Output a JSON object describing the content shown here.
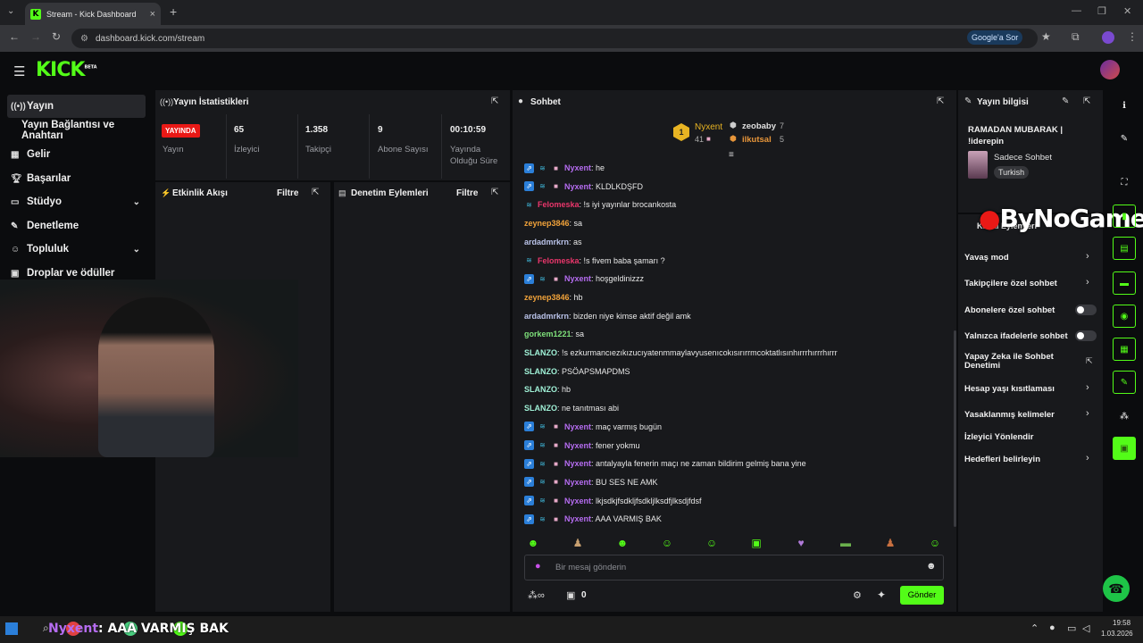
{
  "browser": {
    "tab_title": "Stream - Kick Dashboard",
    "url": "dashboard.kick.com/stream",
    "google_chip": "Google'a Sor"
  },
  "sidebar": {
    "items": [
      {
        "label": "Yayın",
        "icon": "broadcast-icon"
      },
      {
        "label": "Yayın Bağlantısı ve Anahtarı",
        "icon": ""
      },
      {
        "label": "Gelir",
        "icon": "chart-icon"
      },
      {
        "label": "Başarılar",
        "icon": "trophy-icon"
      },
      {
        "label": "Stüdyo",
        "icon": "studio-icon"
      },
      {
        "label": "Denetleme",
        "icon": "wrench-icon"
      },
      {
        "label": "Topluluk",
        "icon": "people-icon"
      },
      {
        "label": "Droplar ve ödüller",
        "icon": "gift-icon"
      }
    ]
  },
  "stats": {
    "title": "Yayın İstatistikleri",
    "live_badge": "YAYINDA",
    "live_label": "Yayın",
    "items": [
      {
        "value": "65",
        "label": "İzleyici"
      },
      {
        "value": "1.358",
        "label": "Takipçi"
      },
      {
        "value": "9",
        "label": "Abone Sayısı"
      },
      {
        "value": "00:10:59",
        "label": "Yayında Olduğu Süre"
      }
    ]
  },
  "activity": {
    "title": "Etkinlik Akışı",
    "filter": "Filtre"
  },
  "moderation": {
    "title": "Denetim Eylemleri",
    "filter": "Filtre"
  },
  "chat": {
    "title": "Sohbet",
    "leaderboard": [
      {
        "rank": "1",
        "name": "Nyxent",
        "count": "41"
      },
      {
        "name": "zeobaby",
        "count": "7"
      },
      {
        "name": "ilkutsal",
        "count": "5"
      }
    ],
    "messages": [
      {
        "user": "Nyxent",
        "color": "#b56cf0",
        "badges": true,
        "text": ": he"
      },
      {
        "user": "Nyxent",
        "color": "#b56cf0",
        "badges": true,
        "text": ": KLDLKDŞFD"
      },
      {
        "user": "Felomeska",
        "color": "#e9366b",
        "badges": "sub",
        "text": ": !s iyi yayınlar brocankosta"
      },
      {
        "user": "zeynep3846",
        "color": "#f0a23a",
        "badges": false,
        "text": ": sa"
      },
      {
        "user": "ardadmrkrn",
        "color": "#b9c2e8",
        "badges": false,
        "text": ": as"
      },
      {
        "user": "Felomeska",
        "color": "#e9366b",
        "badges": "sub",
        "text": ": !s fivem baba şamarı ?"
      },
      {
        "user": "Nyxent",
        "color": "#b56cf0",
        "badges": true,
        "text": ": hoşgeldinizzz"
      },
      {
        "user": "zeynep3846",
        "color": "#f0a23a",
        "badges": false,
        "text": ": hb"
      },
      {
        "user": "ardadmrkrn",
        "color": "#b9c2e8",
        "badges": false,
        "text": ": bizden niye kimse aktif değil amk"
      },
      {
        "user": "gorkem1221",
        "color": "#7ee07a",
        "badges": false,
        "text": ": sa"
      },
      {
        "user": "SLANZO",
        "color": "#9ff0d6",
        "badges": false,
        "text": ": !s ezkurmancıezıkızucıyatenmmaylavyusenıcokısırırrmcoktatlısınhırrrhırrrhırrr"
      },
      {
        "user": "SLANZO",
        "color": "#9ff0d6",
        "badges": false,
        "text": ": PSÖAPSMAPDMS"
      },
      {
        "user": "SLANZO",
        "color": "#9ff0d6",
        "badges": false,
        "text": ": hb"
      },
      {
        "user": "SLANZO",
        "color": "#9ff0d6",
        "badges": false,
        "text": ": ne tanıtması abi"
      },
      {
        "user": "Nyxent",
        "color": "#b56cf0",
        "badges": true,
        "text": ": maç varmış bugün"
      },
      {
        "user": "Nyxent",
        "color": "#b56cf0",
        "badges": true,
        "text": ": fener yokmu"
      },
      {
        "user": "Nyxent",
        "color": "#b56cf0",
        "badges": true,
        "text": ": antalyayla fenerin maçı ne zaman bildirim gelmiş bana yine"
      },
      {
        "user": "Nyxent",
        "color": "#b56cf0",
        "badges": true,
        "text": ": BU SES NE AMK"
      },
      {
        "user": "Nyxent",
        "color": "#b56cf0",
        "badges": true,
        "text": ": lkjsdkjfsdkljfsdkljlksdfjlksdjfdsf"
      },
      {
        "user": "Nyxent",
        "color": "#b56cf0",
        "badges": true,
        "text": ": AAA VARMIŞ BAK"
      }
    ],
    "input_placeholder": "Bir mesaj gönderin",
    "points": "0",
    "send": "Gönder"
  },
  "info": {
    "title": "Yayın bilgisi",
    "stream_title": "RAMADAN MUBARAK | !iderepin",
    "category": "Sadece Sohbet",
    "tag": "Turkish"
  },
  "watermark": "ByNoGame",
  "channel": {
    "title": "Kanal Eylemleri",
    "actions": [
      {
        "label": "Yavaş mod",
        "type": "chevron"
      },
      {
        "label": "Takipçilere özel sohbet",
        "type": "chevron"
      },
      {
        "label": "Abonelere özel sohbet",
        "type": "toggle"
      },
      {
        "label": "Yalnızca ifadelerle sohbet",
        "type": "toggle"
      },
      {
        "label": "Yapay Zeka ile Sohbet Denetimi",
        "type": "external"
      },
      {
        "label": "Hesap yaşı kısıtlaması",
        "type": "chevron"
      },
      {
        "label": "Yasaklanmış kelimeler",
        "type": "chevron"
      },
      {
        "label": "İzleyici Yönlendir",
        "type": "none"
      },
      {
        "label": "Hedefleri belirleyin",
        "type": "chevron"
      }
    ]
  },
  "overlay": {
    "user": "Nyxent",
    "text": "AAA VARMIŞ BAK"
  },
  "taskbar": {
    "time": "19:58",
    "date": "1.03.2026"
  },
  "colors": {
    "kick_green": "#53fc18",
    "live_red": "#e91916",
    "panel": "#18191c"
  }
}
